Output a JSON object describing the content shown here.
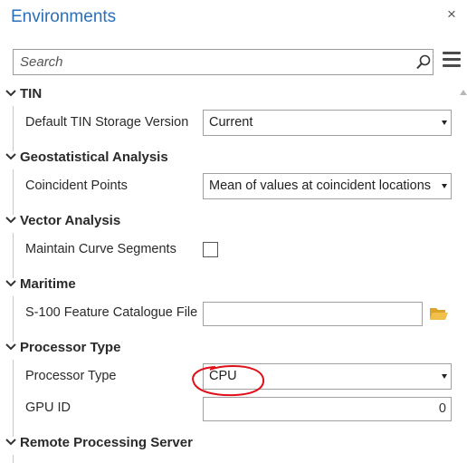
{
  "window": {
    "title": "Environments",
    "close_label": "×"
  },
  "search": {
    "placeholder": "Search"
  },
  "sections": [
    {
      "title": "TIN",
      "params": [
        {
          "label": "Default TIN Storage Version",
          "type": "select",
          "value": "Current"
        }
      ]
    },
    {
      "title": "Geostatistical Analysis",
      "params": [
        {
          "label": "Coincident Points",
          "type": "select",
          "value": "Mean of values at coincident locations"
        }
      ]
    },
    {
      "title": "Vector Analysis",
      "params": [
        {
          "label": "Maintain Curve Segments",
          "type": "checkbox",
          "checked": false
        }
      ]
    },
    {
      "title": "Maritime",
      "params": [
        {
          "label": "S-100 Feature Catalogue File",
          "type": "file",
          "value": ""
        }
      ]
    },
    {
      "title": "Processor Type",
      "params": [
        {
          "label": "Processor Type",
          "type": "select",
          "value": "CPU"
        },
        {
          "label": "GPU ID",
          "type": "number",
          "value": "0"
        }
      ]
    },
    {
      "title": "Remote Processing Server",
      "params": []
    }
  ],
  "colors": {
    "title": "#2b6fb8",
    "annotation": "#e0101a",
    "folder_icon": "#e3b341"
  },
  "icons": [
    "close-icon",
    "search-icon",
    "hamburger-menu-icon",
    "chevron-down-icon",
    "folder-icon",
    "dropdown-arrow-icon"
  ]
}
